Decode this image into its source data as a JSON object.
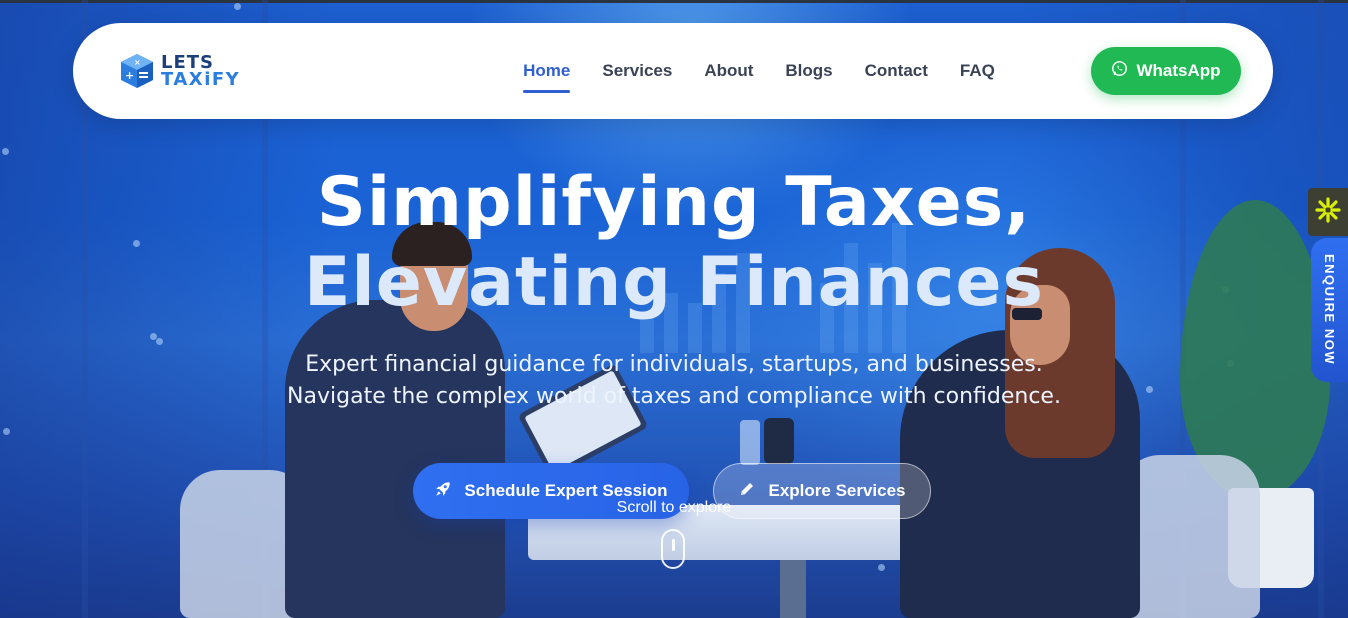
{
  "brand": {
    "logo_line1": "LETS",
    "logo_line2": "TAXiFY",
    "primary_color": "#2f5fd0",
    "whatsapp_color": "#20b954"
  },
  "nav": {
    "items": [
      {
        "label": "Home",
        "active": true
      },
      {
        "label": "Services",
        "active": false
      },
      {
        "label": "About",
        "active": false
      },
      {
        "label": "Blogs",
        "active": false
      },
      {
        "label": "Contact",
        "active": false
      },
      {
        "label": "FAQ",
        "active": false
      }
    ],
    "whatsapp_label": "WhatsApp",
    "whatsapp_icon": "whatsapp-icon"
  },
  "hero": {
    "headline_line1": "Simplifying Taxes,",
    "headline_line2": "Elevating Finances",
    "subtitle_line1": "Expert financial guidance for individuals, startups, and businesses.",
    "subtitle_line2": "Navigate the complex world of taxes and compliance with confidence.",
    "primary_button": {
      "label": "Schedule Expert Session",
      "icon": "rocket-icon"
    },
    "secondary_button": {
      "label": "Explore Services",
      "icon": "pencil-icon"
    },
    "scroll_hint": "Scroll to explore"
  },
  "side": {
    "widget_icon": "asterisk-icon",
    "enquire_label": "ENQUIRE NOW"
  }
}
